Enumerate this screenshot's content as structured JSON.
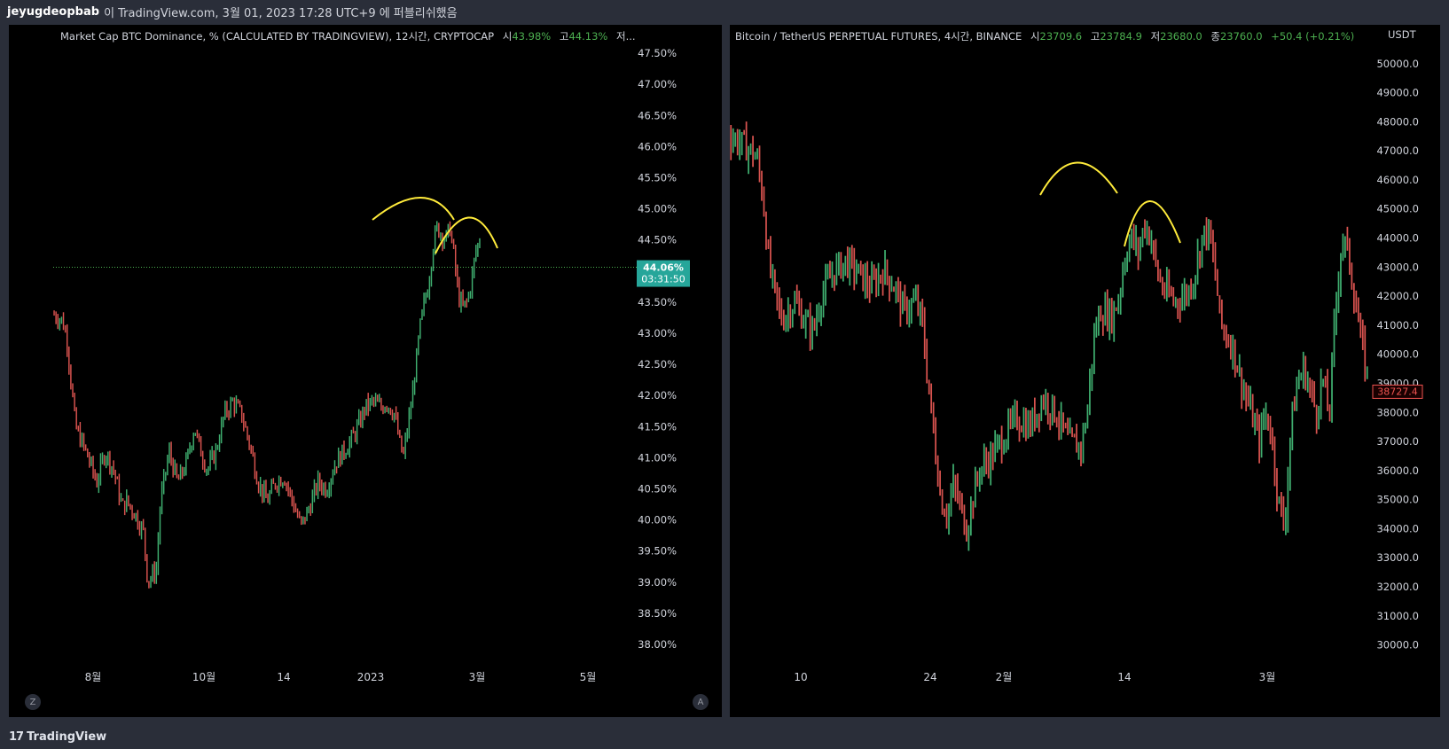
{
  "header": {
    "user": "jeyugdeopbab",
    "text": "이 TradingView.com, 3월 01, 2023 17:28 UTC+9 에 퍼블리쉬했음"
  },
  "footer": {
    "brand": "TradingView",
    "logo_glyph": "17"
  },
  "left_panel": {
    "legend": {
      "title": "Market Cap BTC Dominance, % (CALCULATED BY TRADINGVIEW), 12시간, CRYPTOCAP",
      "open_label": "시",
      "open": "43.98%",
      "high_label": "고",
      "high": "44.13%",
      "low_label": "저..."
    },
    "price_badge": {
      "value": "44.06%",
      "countdown": "03:31:50"
    },
    "buttons": {
      "left": "Z",
      "right": "A"
    }
  },
  "right_panel": {
    "legend": {
      "title": "Bitcoin / TetherUS PERPETUAL FUTURES, 4시간, BINANCE",
      "open_label": "시",
      "open": "23709.6",
      "high_label": "고",
      "high": "23784.9",
      "low_label": "저",
      "low": "23680.0",
      "close_label": "종",
      "close": "23760.0",
      "change": "+50.4 (+0.21%)"
    },
    "currency": "USDT",
    "price_badge": {
      "value": "38727.4"
    }
  },
  "colors": {
    "up": "#3fae6f",
    "down": "#d9534f",
    "annotation": "#ffeb3b",
    "badge_green": "#26a69a",
    "badge_red": "#ef5350"
  },
  "chart_data": [
    {
      "type": "candlestick",
      "title": "Market Cap BTC Dominance, % (CALCULATED BY TRADINGVIEW), 12시간, CRYPTOCAP",
      "ylim": [
        37.8,
        47.8
      ],
      "yticks": [
        "47.50%",
        "47.00%",
        "46.50%",
        "46.00%",
        "45.50%",
        "45.00%",
        "44.50%",
        "44.00%",
        "43.50%",
        "43.00%",
        "42.50%",
        "42.00%",
        "41.50%",
        "41.00%",
        "40.50%",
        "40.00%",
        "39.50%",
        "39.00%",
        "38.50%",
        "38.00%"
      ],
      "ytick_values": [
        47.5,
        47.0,
        46.5,
        46.0,
        45.5,
        45.0,
        44.5,
        44.0,
        43.5,
        43.0,
        42.5,
        42.0,
        41.5,
        41.0,
        40.5,
        40.0,
        39.5,
        39.0,
        38.5,
        38.0
      ],
      "xticks": [
        "8월",
        "10월",
        "14",
        "2023",
        "3월",
        "5월"
      ],
      "current_value": 44.06,
      "path": [
        [
          0,
          43.3
        ],
        [
          0.02,
          43.2
        ],
        [
          0.03,
          42.9
        ],
        [
          0.05,
          41.5
        ],
        [
          0.08,
          41.0
        ],
        [
          0.1,
          40.6
        ],
        [
          0.12,
          41.1
        ],
        [
          0.14,
          40.8
        ],
        [
          0.16,
          40.2
        ],
        [
          0.17,
          40.3
        ],
        [
          0.19,
          40.1
        ],
        [
          0.21,
          39.8
        ],
        [
          0.22,
          39.0
        ],
        [
          0.24,
          39.2
        ],
        [
          0.25,
          40.3
        ],
        [
          0.27,
          41.1
        ],
        [
          0.29,
          40.6
        ],
        [
          0.31,
          40.9
        ],
        [
          0.33,
          41.5
        ],
        [
          0.34,
          41.2
        ],
        [
          0.36,
          40.8
        ],
        [
          0.38,
          41.1
        ],
        [
          0.4,
          41.7
        ],
        [
          0.42,
          41.9
        ],
        [
          0.44,
          41.7
        ],
        [
          0.46,
          41.2
        ],
        [
          0.48,
          40.6
        ],
        [
          0.5,
          40.3
        ],
        [
          0.52,
          40.6
        ],
        [
          0.54,
          40.7
        ],
        [
          0.56,
          40.3
        ],
        [
          0.58,
          39.9
        ],
        [
          0.6,
          40.2
        ],
        [
          0.62,
          40.6
        ],
        [
          0.64,
          40.5
        ],
        [
          0.66,
          40.9
        ],
        [
          0.68,
          41.1
        ],
        [
          0.7,
          41.3
        ],
        [
          0.72,
          41.6
        ],
        [
          0.73,
          41.8
        ],
        [
          0.75,
          41.9
        ],
        [
          0.77,
          41.8
        ],
        [
          0.78,
          41.9
        ],
        [
          0.8,
          41.7
        ],
        [
          0.81,
          41.3
        ],
        [
          0.82,
          41.0
        ],
        [
          0.84,
          41.9
        ],
        [
          0.85,
          42.5
        ],
        [
          0.86,
          43.1
        ],
        [
          0.87,
          43.5
        ],
        [
          0.88,
          43.8
        ],
        [
          0.89,
          44.4
        ],
        [
          0.9,
          44.7
        ],
        [
          0.91,
          44.6
        ],
        [
          0.92,
          44.5
        ],
        [
          0.93,
          44.7
        ],
        [
          0.94,
          44.2
        ],
        [
          0.95,
          43.6
        ],
        [
          0.96,
          43.4
        ],
        [
          0.97,
          43.5
        ],
        [
          0.98,
          43.8
        ],
        [
          0.99,
          44.3
        ],
        [
          1.0,
          44.5
        ]
      ],
      "annotations": [
        "arc",
        "arc"
      ]
    },
    {
      "type": "candlestick",
      "title": "Bitcoin / TetherUS PERPETUAL FUTURES, 4시간, BINANCE",
      "ylim": [
        29500,
        51000
      ],
      "yticks": [
        "50000.0",
        "49000.0",
        "48000.0",
        "47000.0",
        "46000.0",
        "45000.0",
        "44000.0",
        "43000.0",
        "42000.0",
        "41000.0",
        "40000.0",
        "39000.0",
        "38000.0",
        "37000.0",
        "36000.0",
        "35000.0",
        "34000.0",
        "33000.0",
        "32000.0",
        "31000.0",
        "30000.0"
      ],
      "ytick_values": [
        50000,
        49000,
        48000,
        47000,
        46000,
        45000,
        44000,
        43000,
        42000,
        41000,
        40000,
        39000,
        38000,
        37000,
        36000,
        35000,
        34000,
        33000,
        32000,
        31000,
        30000
      ],
      "xticks": [
        "10",
        "24",
        "2월",
        "14",
        "3월"
      ],
      "current_value": 38727.4,
      "path": [
        [
          0,
          47.5
        ],
        [
          0.02,
          47.2
        ],
        [
          0.04,
          46.8
        ],
        [
          0.05,
          45.5
        ],
        [
          0.06,
          43.0
        ],
        [
          0.07,
          42.0
        ],
        [
          0.08,
          41.2
        ],
        [
          0.1,
          41.8
        ],
        [
          0.12,
          41.0
        ],
        [
          0.13,
          40.8
        ],
        [
          0.14,
          41.9
        ],
        [
          0.16,
          42.8
        ],
        [
          0.18,
          43.2
        ],
        [
          0.2,
          42.8
        ],
        [
          0.22,
          42.3
        ],
        [
          0.24,
          42.9
        ],
        [
          0.26,
          42.2
        ],
        [
          0.27,
          41.5
        ],
        [
          0.29,
          41.8
        ],
        [
          0.3,
          41.2
        ],
        [
          0.31,
          39.0
        ],
        [
          0.32,
          37.0
        ],
        [
          0.33,
          35.0
        ],
        [
          0.34,
          34.5
        ],
        [
          0.35,
          35.5
        ],
        [
          0.36,
          34.8
        ],
        [
          0.37,
          34.0
        ],
        [
          0.38,
          35.0
        ],
        [
          0.39,
          36.0
        ],
        [
          0.41,
          36.5
        ],
        [
          0.43,
          37.2
        ],
        [
          0.45,
          37.8
        ],
        [
          0.47,
          37.5
        ],
        [
          0.49,
          38.5
        ],
        [
          0.51,
          38.0
        ],
        [
          0.53,
          37.0
        ],
        [
          0.55,
          36.8
        ],
        [
          0.56,
          38.0
        ],
        [
          0.57,
          40.5
        ],
        [
          0.58,
          41.5
        ],
        [
          0.6,
          41.3
        ],
        [
          0.61,
          42.0
        ],
        [
          0.62,
          43.5
        ],
        [
          0.63,
          44.0
        ],
        [
          0.64,
          43.5
        ],
        [
          0.65,
          44.5
        ],
        [
          0.66,
          44.0
        ],
        [
          0.67,
          42.8
        ],
        [
          0.68,
          42.2
        ],
        [
          0.7,
          41.8
        ],
        [
          0.72,
          42.2
        ],
        [
          0.73,
          42.9
        ],
        [
          0.74,
          44.0
        ],
        [
          0.75,
          44.3
        ],
        [
          0.76,
          43.0
        ],
        [
          0.77,
          41.0
        ],
        [
          0.79,
          40.2
        ],
        [
          0.8,
          39.2
        ],
        [
          0.81,
          38.5
        ],
        [
          0.82,
          37.8
        ],
        [
          0.83,
          37.0
        ],
        [
          0.84,
          38.0
        ],
        [
          0.85,
          37.2
        ],
        [
          0.86,
          35.0
        ],
        [
          0.87,
          34.0
        ],
        [
          0.88,
          37.5
        ],
        [
          0.89,
          39.0
        ],
        [
          0.9,
          39.5
        ],
        [
          0.91,
          38.8
        ],
        [
          0.92,
          38.0
        ],
        [
          0.93,
          39.2
        ],
        [
          0.94,
          37.8
        ],
        [
          0.95,
          41.5
        ],
        [
          0.96,
          44.0
        ],
        [
          0.97,
          43.5
        ],
        [
          0.98,
          42.0
        ],
        [
          0.99,
          40.5
        ],
        [
          1.0,
          39.2
        ]
      ],
      "path_unit": "thousands"
    }
  ]
}
